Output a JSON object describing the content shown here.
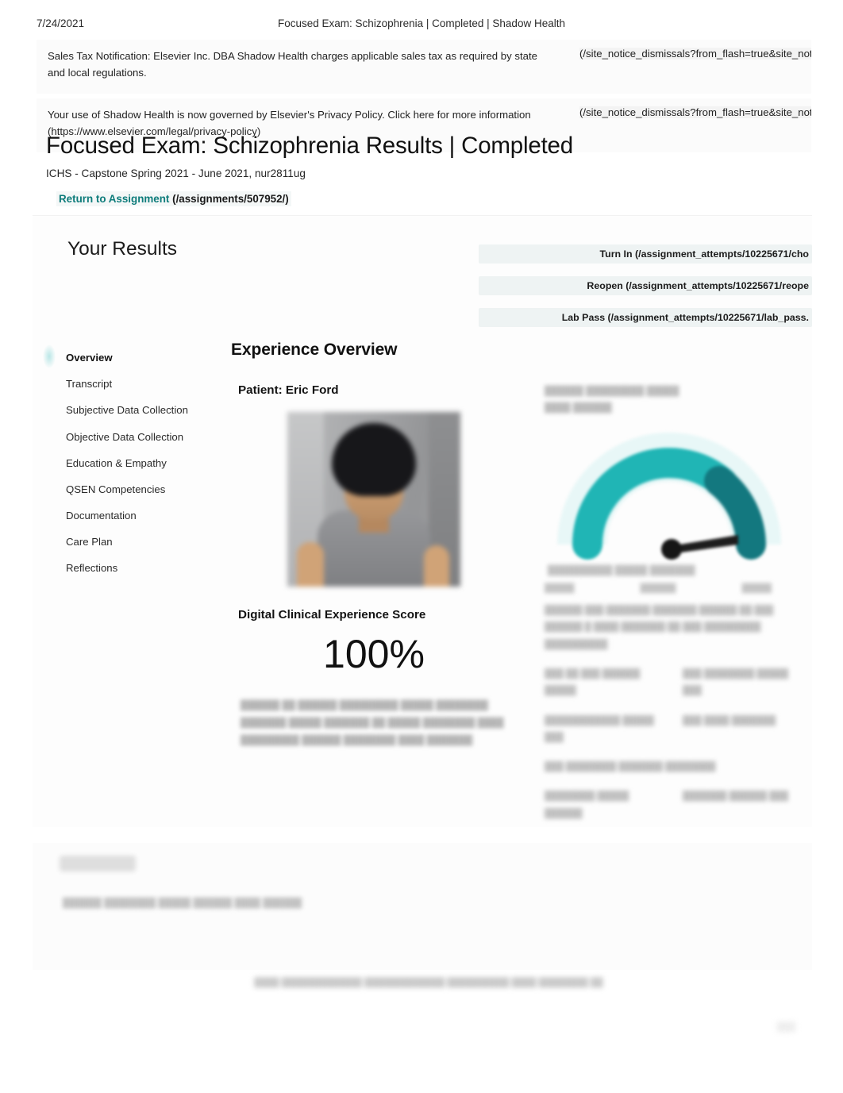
{
  "print_header": {
    "date": "7/24/2021",
    "title": "Focused Exam: Schizophrenia | Completed | Shadow Health"
  },
  "notices": [
    {
      "body": "Sales Tax Notification: Elsevier Inc. DBA Shadow Health charges applicable sales tax as required by state and local regulations.",
      "link": "(/site_notice_dismissals?from_flash=true&site_noti"
    },
    {
      "body": "Your use of Shadow Health is now governed by Elsevier's Privacy Policy. Click here for more information (https://www.elsevier.com/legal/privacy-policy)",
      "link": "(/site_notice_dismissals?from_flash=true&site_noti"
    }
  ],
  "title_block": {
    "title": "Focused Exam: Schizophrenia Results | Completed",
    "subtitle": "ICHS - Capstone Spring 2021 - June 2021, nur2811ug",
    "return_label": "Return to Assignment",
    "return_url": "(/assignments/507952/)"
  },
  "results": {
    "heading": "Your Results",
    "actions": [
      "Turn In (/assignment_attempts/10225671/cho",
      "Reopen (/assignment_attempts/10225671/reope",
      "Lab Pass (/assignment_attempts/10225671/lab_pass."
    ]
  },
  "sidebar": {
    "items": [
      {
        "label": "Overview",
        "active": true
      },
      {
        "label": "Transcript",
        "active": false
      },
      {
        "label": "Subjective Data Collection",
        "active": false
      },
      {
        "label": "Objective Data Collection",
        "active": false
      },
      {
        "label": "Education & Empathy",
        "active": false
      },
      {
        "label": "QSEN Competencies",
        "active": false
      },
      {
        "label": "Documentation",
        "active": false
      },
      {
        "label": "Care Plan",
        "active": false
      },
      {
        "label": "Reflections",
        "active": false
      }
    ]
  },
  "main": {
    "section_title": "Experience Overview",
    "patient_label": "Patient: Eric Ford",
    "score_label": "Digital Clinical Experience Score",
    "score_value": "100%",
    "score_note_redacted": "██████ ██ ██████ █████████ █████ ████████ ███████ █████ ███████ ██ █████ ████████ ████ █████████ ██████ ████████ ████ ███████"
  },
  "gauge": {
    "heading_redacted": "██████ █████████ █████ ████ ██████",
    "caption_redacted": "██████████ █████  ███████",
    "ticks_redacted": [
      "█████",
      "██████",
      "█████"
    ],
    "details_redacted": "██████ ███ ███████ ███████ ██████ ██ ███ ██████ █ ████ ███████ ██ ███ █████████ ██████████",
    "row1_left_redacted": "███ ██ ███ ██████ █████",
    "row1_right_redacted": "███ ████████ █████ ███",
    "row2_left_redacted": "████████████ █████ ███",
    "row2_right_redacted": "███ ████ ███████",
    "row3_left_redacted": "███  ████████  ███████ ████████",
    "row4_left_redacted": "████████ █████ ██████",
    "row4_right_redacted": "███████ ██████ ███"
  },
  "lower_card": {
    "text_redacted": "██████ ████████ █████ ██████ ████ ██████"
  },
  "footer": {
    "text_redacted": "████  █████████████ █████████████  ██████████  ████ ████████ ██",
    "page_redacted": "███"
  },
  "colors": {
    "teal_accent": "#1FB2B2",
    "teal_dark": "#11787F",
    "link_teal": "#0E7C7B",
    "text": "#1A1A1A"
  },
  "chart_data": {
    "type": "gauge",
    "title": "Student Performance Index",
    "value": 100,
    "min": 0,
    "max": 100,
    "arc_start_deg": 180,
    "arc_end_deg": 0,
    "needle_deg": 8,
    "segments": [
      {
        "name": "lower",
        "from": 0,
        "to": 72,
        "color": "#1FB2B2"
      },
      {
        "name": "upper",
        "from": 72,
        "to": 100,
        "color": "#11787F"
      }
    ],
    "tick_labels": [
      "█████",
      "██████",
      "█████"
    ],
    "legend": [],
    "note": "Gauge labels are blurred/redacted in the source screenshot"
  }
}
